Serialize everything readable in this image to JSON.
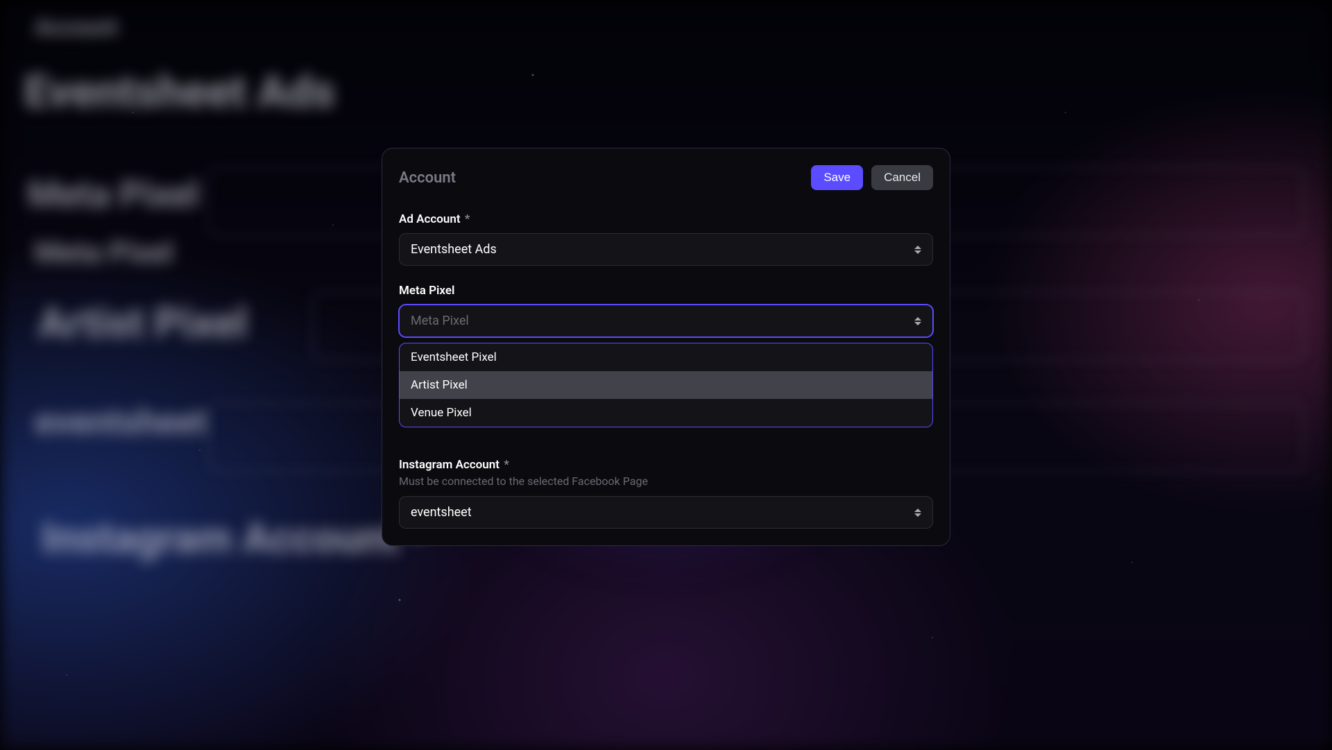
{
  "modal": {
    "title": "Account",
    "save_label": "Save",
    "cancel_label": "Cancel"
  },
  "fields": {
    "ad_account": {
      "label": "Ad Account",
      "required": "*",
      "value": "Eventsheet Ads"
    },
    "meta_pixel": {
      "label": "Meta Pixel",
      "placeholder": "Meta Pixel",
      "options": [
        "Eventsheet Pixel",
        "Artist Pixel",
        "Venue Pixel"
      ],
      "highlighted_index": 1
    },
    "instagram": {
      "label": "Instagram Account",
      "required": "*",
      "hint": "Must be connected to the selected Facebook Page",
      "value": "eventsheet"
    }
  },
  "background_text": {
    "label1": "Account",
    "heading1": "Eventsheet Ads",
    "label2": "Meta Pixel",
    "label3": "Meta Pixel",
    "heading2": "Artist Pixel",
    "label4": "eventsheet",
    "heading3": "Instagram Account *"
  },
  "colors": {
    "primary": "#5b4cff",
    "surface": "#0a0a0f",
    "border": "#2a2a45"
  }
}
